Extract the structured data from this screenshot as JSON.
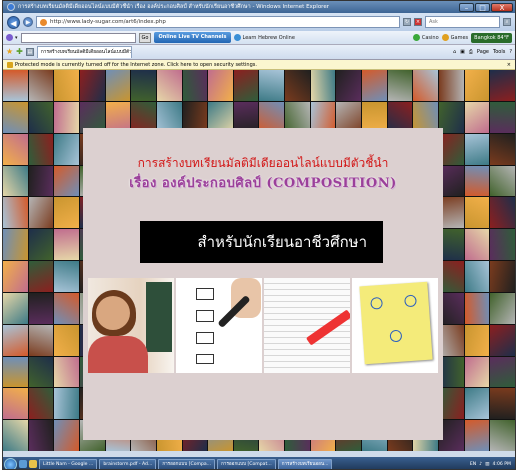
{
  "window": {
    "title": "การสร้างบทเรียนมัลติมีเดียออนไลน์แบบมีตัวชี้นำ เรื่อง องค์ประกอบศิลป์ สำหรับนักเรียนอาชีวศึกษา - Windows Internet Explorer",
    "minimize": "–",
    "maximize": "□",
    "close": "X"
  },
  "address_bar": {
    "url": "http://www.lady-sugar.com/art6/index.php",
    "search_placeholder": "Ask"
  },
  "toolbar": {
    "go_label": "Go",
    "tv_label": "Online Live TV Channels",
    "hebrew_label": "Learn Hebrew Online",
    "casino_label": "Casino",
    "games_label": "Games",
    "weather_label": "Bangkok 84°F"
  },
  "favorites_bar": {
    "tab_label": "การสร้างบทเรียนมัลติมีเดียออนไลน์แบบมีตัวชี้นำ เรื่อง องค์ประกอบ...",
    "page_label": "Page",
    "tools_label": "Tools"
  },
  "info_bar": {
    "message": "Protected mode is currently turned off for the Internet zone. Click here to open security settings."
  },
  "content": {
    "headline": "การสร้างบทเรียนมัลติมีเดียออนไลน์แบบมีตัวชี้นำ",
    "subheadline": "เรื่อง องค์ประกอบศิลป์ (COMPOSITION)",
    "audience": "สำหรับนักเรียนอาชีวศึกษา"
  },
  "taskbar": {
    "tasks": [
      "Little Nam - Google ...",
      "brainstorm.pdf - Ad...",
      "การออกแบบ [Compa...",
      "การออกแบบ [Compat...",
      "การสร้างบทเรียนออน..."
    ],
    "language": "EN",
    "clock": "4:06 PM"
  },
  "colors": {
    "headline": "#d21616",
    "subheadline": "#9b3f9a",
    "card_background": "#dcd0d0",
    "audience_bar": "#000000"
  }
}
